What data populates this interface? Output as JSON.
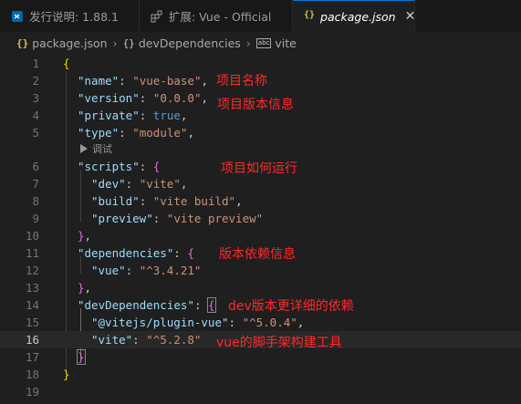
{
  "tabs": [
    {
      "label": "发行说明: 1.88.1",
      "icon": "vscode-icon",
      "active": false
    },
    {
      "label": "扩展: Vue - Official",
      "icon": "extensions-icon",
      "active": false
    },
    {
      "label": "package.json",
      "icon": "json-braces-icon",
      "active": true,
      "close": "✕"
    }
  ],
  "breadcrumb": {
    "file": "package.json",
    "path1": "devDependencies",
    "path2": "vite"
  },
  "codelens": "调试",
  "lines": [
    {
      "n": "1",
      "text": "{"
    },
    {
      "n": "2",
      "text": "\"name\": \"vue-base\","
    },
    {
      "n": "3",
      "text": "\"version\": \"0.0.0\","
    },
    {
      "n": "4",
      "text": "\"private\": true,"
    },
    {
      "n": "5",
      "text": "\"type\": \"module\","
    },
    {
      "n": "6",
      "text": "\"scripts\": {"
    },
    {
      "n": "7",
      "text": "\"dev\": \"vite\","
    },
    {
      "n": "8",
      "text": "\"build\": \"vite build\","
    },
    {
      "n": "9",
      "text": "\"preview\": \"vite preview\""
    },
    {
      "n": "10",
      "text": "},"
    },
    {
      "n": "11",
      "text": "\"dependencies\": {"
    },
    {
      "n": "12",
      "text": "\"vue\": \"^3.4.21\""
    },
    {
      "n": "13",
      "text": "},"
    },
    {
      "n": "14",
      "text": "\"devDependencies\": {"
    },
    {
      "n": "15",
      "text": "\"@vitejs/plugin-vue\": \"^5.0.4\","
    },
    {
      "n": "16",
      "text": "\"vite\": \"^5.2.8\""
    },
    {
      "n": "17",
      "text": "}"
    },
    {
      "n": "18",
      "text": "}"
    },
    {
      "n": "19",
      "text": ""
    }
  ],
  "annotations": {
    "name": "项目名称",
    "version": "项目版本信息",
    "scripts": "项目如何运行",
    "dependencies": "版本依赖信息",
    "devDependencies": "dev版本更详细的依赖",
    "vite": "vue的脚手架构建工具"
  },
  "colors": {
    "key": "#9cdcfe",
    "string": "#ce9178",
    "annotation": "#ff2a2a",
    "bracket_level1": "#ffd700",
    "bracket_level2": "#da70d6",
    "bracket_level3": "#179fff"
  }
}
